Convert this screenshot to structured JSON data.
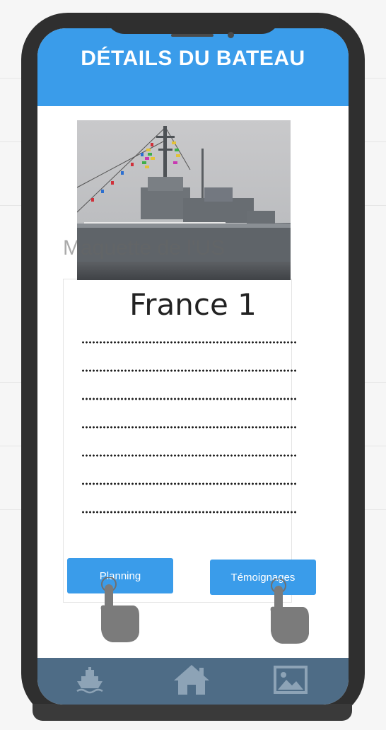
{
  "header": {
    "title": "DÉTAILS DU BATEAU"
  },
  "boat": {
    "photo_icon": "warship-photo",
    "caption": "Maquette de l'US",
    "name": "France 1",
    "detail_lines": [
      "..................................................",
      "..................................................",
      "..................................................",
      "..................................................",
      "..................................................",
      "..................................................",
      ".................................................."
    ]
  },
  "actions": {
    "planning_label": "Planning",
    "temoignages_label": "Témoignages",
    "tap_icon": "tap-hand-icon"
  },
  "bottom_nav": {
    "items": [
      {
        "icon": "ship-icon"
      },
      {
        "icon": "home-icon"
      },
      {
        "icon": "image-icon"
      }
    ]
  },
  "colors": {
    "accent": "#3a9cea",
    "nav_bg": "#4e6c86",
    "phone_frame": "#2f2f2f"
  }
}
